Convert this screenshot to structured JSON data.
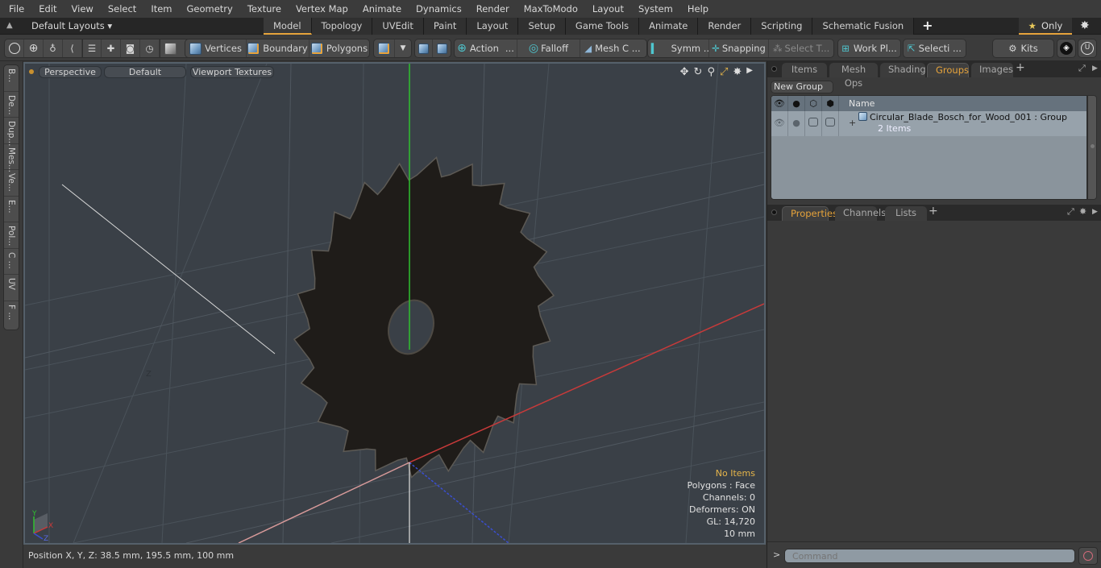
{
  "menubar": [
    "File",
    "Edit",
    "View",
    "Select",
    "Item",
    "Geometry",
    "Texture",
    "Vertex Map",
    "Animate",
    "Dynamics",
    "Render",
    "MaxToModo",
    "Layout",
    "System",
    "Help"
  ],
  "layouts": {
    "label": "Default Layouts ▾"
  },
  "layout_tabs": [
    {
      "label": "Model",
      "active": true
    },
    {
      "label": "Topology"
    },
    {
      "label": "UVEdit"
    },
    {
      "label": "Paint"
    },
    {
      "label": "Layout"
    },
    {
      "label": "Setup"
    },
    {
      "label": "Game Tools"
    },
    {
      "label": "Animate"
    },
    {
      "label": "Render"
    },
    {
      "label": "Scripting"
    },
    {
      "label": "Schematic Fusion"
    }
  ],
  "only_label": "Only",
  "toolbar": {
    "vertices": "Vertices",
    "boundary": "Boundary",
    "polygons": "Polygons",
    "action": "Action",
    "action_more": "...",
    "falloff": "Falloff",
    "mesh_c": "Mesh C ...",
    "symm": "Symm ...",
    "snapping": "Snapping",
    "select_t": "Select T...",
    "work_pl": "Work Pl...",
    "selecti": "Selecti ...",
    "kits": "Kits"
  },
  "left_tabs": [
    "B...",
    "De...",
    "Dup...",
    "Mes...",
    "Ve...",
    "E...",
    "Pol...",
    "C ...",
    "UV",
    "F ..."
  ],
  "viewport": {
    "view_mode": "Perspective",
    "shading": "Default",
    "textures": "Viewport Textures",
    "stats": {
      "items": "No Items",
      "polygons": "Polygons : Face",
      "channels": "Channels: 0",
      "deformers": "Deformers: ON",
      "gl": "GL: 14,720",
      "grid": "10 mm"
    },
    "axis_labels": {
      "x": "X",
      "y": "Y",
      "z": "Z"
    }
  },
  "statusbar": {
    "position": "Position X, Y, Z:   38.5 mm, 195.5 mm, 100 mm"
  },
  "right_panel": {
    "top_tabs": [
      {
        "label": "Items"
      },
      {
        "label": "Mesh Ops"
      },
      {
        "label": "Shading"
      },
      {
        "label": "Groups",
        "active": true
      },
      {
        "label": "Images"
      }
    ],
    "new_group": "New Group",
    "table": {
      "name_header": "Name",
      "rows": [
        {
          "name": "Circular_Blade_Bosch_for_Wood_001 : Group",
          "sub": "2 Items"
        }
      ]
    },
    "bottom_tabs": [
      {
        "label": "Properties",
        "active": true
      },
      {
        "label": "Channels"
      },
      {
        "label": "Lists"
      }
    ],
    "command_placeholder": "Command"
  },
  "colors": {
    "accent": "#e6a33b",
    "axis_x": "#c83a3a",
    "axis_y": "#2fc02f",
    "axis_z": "#3a4ed0",
    "viewport_bg": "#3a4047"
  }
}
